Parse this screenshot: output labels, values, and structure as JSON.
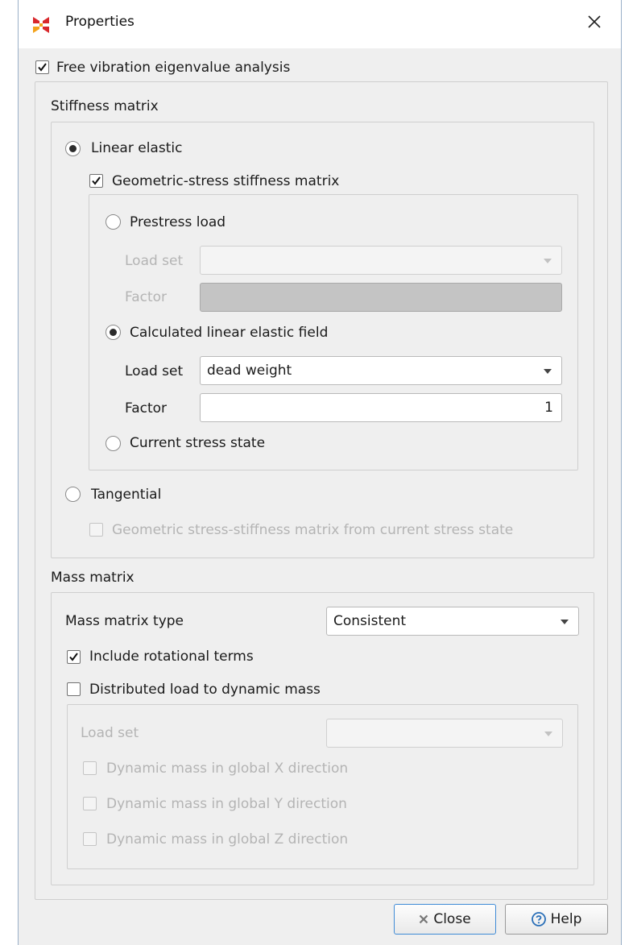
{
  "window": {
    "title": "Properties",
    "close_glyph": "✕"
  },
  "analysis": {
    "free_vibration_label": "Free vibration eigenvalue analysis",
    "free_vibration_checked": true
  },
  "stiffness": {
    "group_title": "Stiffness matrix",
    "linear_elastic_label": "Linear elastic",
    "linear_elastic_selected": true,
    "geometric_stress_label": "Geometric-stress stiffness matrix",
    "geometric_stress_checked": true,
    "prestress_load_label": "Prestress load",
    "prestress_load_set_label": "Load set",
    "prestress_load_set_value": "",
    "prestress_factor_label": "Factor",
    "prestress_factor_value": "",
    "calculated_label": "Calculated linear elastic field",
    "calculated_selected": true,
    "load_set_label": "Load set",
    "load_set_value": "dead weight",
    "factor_label": "Factor",
    "factor_value": "1",
    "current_stress_label": "Current stress state",
    "tangential_label": "Tangential",
    "tangential_selected": false,
    "tangential_geom_label": "Geometric stress-stiffness matrix from current stress state",
    "tangential_geom_checked": false
  },
  "mass": {
    "group_title": "Mass matrix",
    "type_label": "Mass matrix type",
    "type_value": "Consistent",
    "include_rotational_label": "Include rotational terms",
    "include_rotational_checked": true,
    "distributed_load_label": "Distributed load  to dynamic mass",
    "distributed_load_checked": false,
    "load_set_label": "Load set",
    "load_set_value": "",
    "dyn_x_label": "Dynamic mass in global X direction",
    "dyn_y_label": "Dynamic mass in global Y direction",
    "dyn_z_label": "Dynamic mass in global Z direction"
  },
  "buttons": {
    "close_label": "Close",
    "help_label": "Help"
  },
  "colors": {
    "focus_border": "#3f8bd6",
    "help_icon": "#2a6fb8",
    "app_icon_red": "#d8272b",
    "app_icon_orange": "#f3a21b"
  }
}
